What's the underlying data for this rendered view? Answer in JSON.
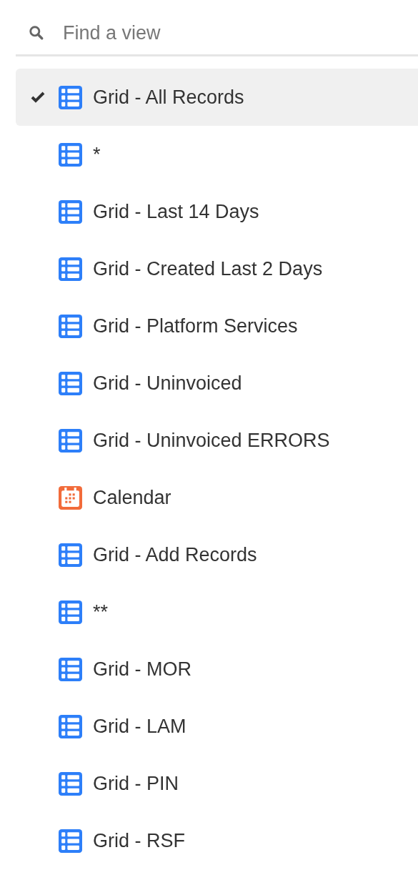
{
  "search": {
    "placeholder": "Find a view"
  },
  "views": [
    {
      "label": "Grid - All Records",
      "kind": "grid",
      "selected": true
    },
    {
      "label": "*",
      "kind": "grid",
      "selected": false
    },
    {
      "label": "Grid - Last 14 Days",
      "kind": "grid",
      "selected": false
    },
    {
      "label": "Grid - Created Last 2 Days",
      "kind": "grid",
      "selected": false
    },
    {
      "label": "Grid - Platform Services",
      "kind": "grid",
      "selected": false
    },
    {
      "label": "Grid - Uninvoiced",
      "kind": "grid",
      "selected": false
    },
    {
      "label": "Grid - Uninvoiced ERRORS",
      "kind": "grid",
      "selected": false
    },
    {
      "label": "Calendar",
      "kind": "calendar",
      "selected": false
    },
    {
      "label": "Grid - Add Records",
      "kind": "grid",
      "selected": false
    },
    {
      "label": "**",
      "kind": "grid",
      "selected": false
    },
    {
      "label": "Grid - MOR",
      "kind": "grid",
      "selected": false
    },
    {
      "label": "Grid - LAM",
      "kind": "grid",
      "selected": false
    },
    {
      "label": "Grid - PIN",
      "kind": "grid",
      "selected": false
    },
    {
      "label": "Grid - RSF",
      "kind": "grid",
      "selected": false
    }
  ]
}
